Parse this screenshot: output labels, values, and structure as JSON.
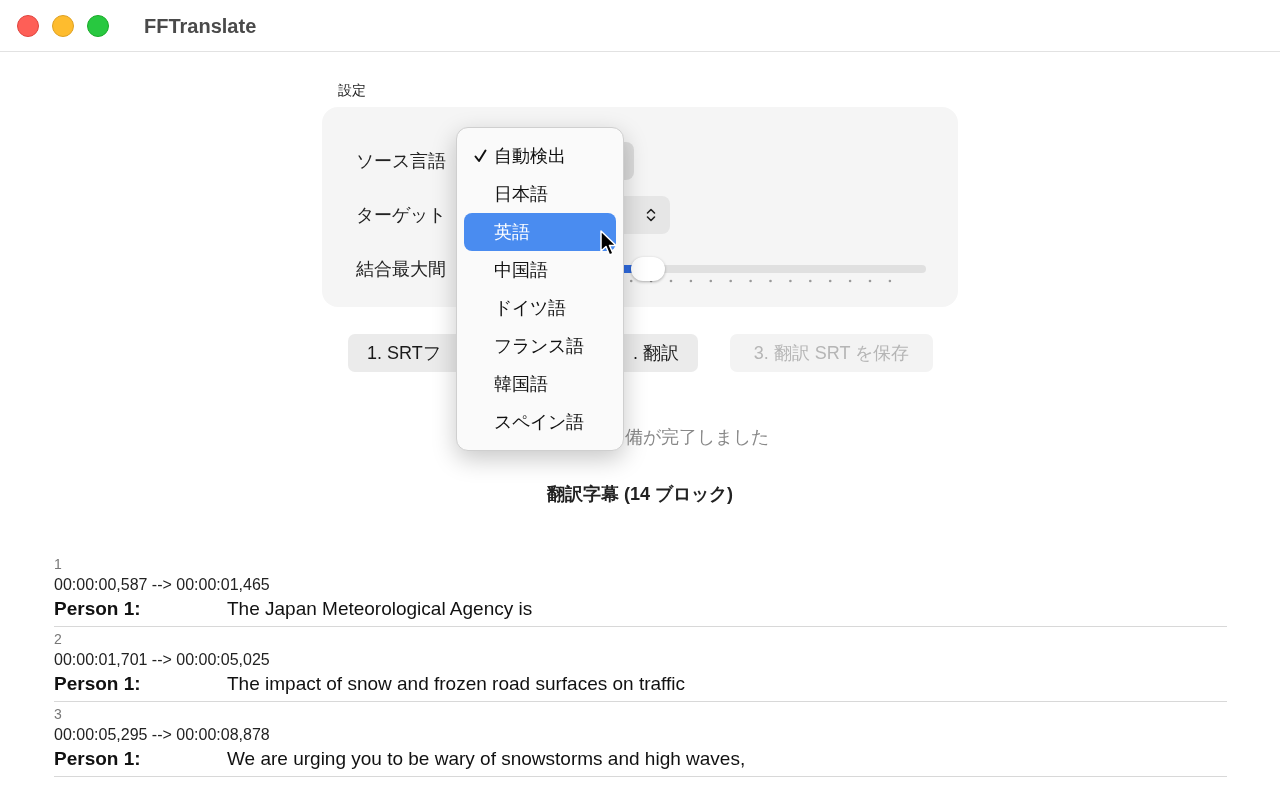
{
  "window": {
    "title": "FFTranslate"
  },
  "settings": {
    "caption": "設定",
    "source_label": "ソース言語",
    "target_label": "ターゲット",
    "gap_label": "結合最大間",
    "gap_slider": {
      "level": 0.4
    }
  },
  "buttons": [
    {
      "label": "1. SRTフ",
      "disabled": false
    },
    {
      "label": ". 翻訳",
      "disabled": false
    },
    {
      "label": "3. 翻訳 SRT を保存",
      "disabled": true
    }
  ],
  "status": "備が完了しました",
  "subtitles_title": "翻訳字幕 (14 ブロック)",
  "blocks": [
    {
      "index": "1",
      "time": "00:00:00,587 --> 00:00:01,465",
      "speaker": "Person 1:",
      "text": "The Japan Meteorological Agency is"
    },
    {
      "index": "2",
      "time": "00:00:01,701 --> 00:00:05,025",
      "speaker": "Person 1:",
      "text": "The impact of snow and frozen road surfaces on traffic"
    },
    {
      "index": "3",
      "time": "00:00:05,295 --> 00:00:08,878",
      "speaker": "Person 1:",
      "text": "We are urging you to be wary of snowstorms and high waves,"
    }
  ],
  "language_menu": [
    {
      "label": "自動検出",
      "checked": true,
      "selected": false
    },
    {
      "label": "日本語",
      "checked": false,
      "selected": false
    },
    {
      "label": "英語",
      "checked": false,
      "selected": true
    },
    {
      "label": "中国語",
      "checked": false,
      "selected": false
    },
    {
      "label": "ドイツ語",
      "checked": false,
      "selected": false
    },
    {
      "label": "フランス語",
      "checked": false,
      "selected": false
    },
    {
      "label": "韓国語",
      "checked": false,
      "selected": false
    },
    {
      "label": "スペイン語",
      "checked": false,
      "selected": false
    }
  ]
}
